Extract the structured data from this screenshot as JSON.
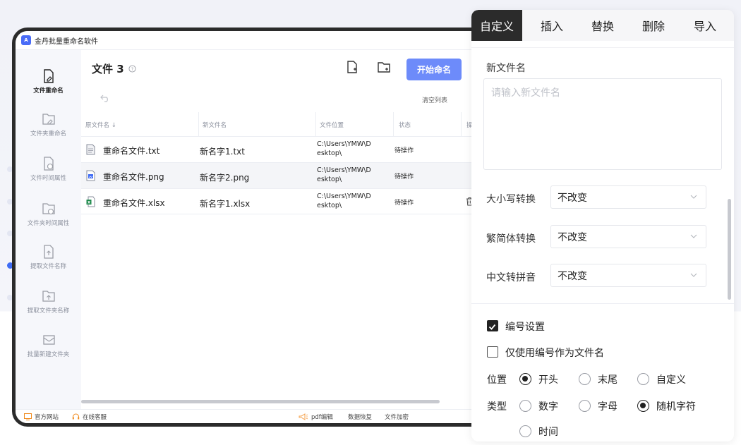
{
  "app": {
    "title": "金丹批量重命名软件"
  },
  "sidebar": {
    "items": [
      {
        "label": "文件重命名",
        "icon": "file-edit-icon"
      },
      {
        "label": "文件夹重命名",
        "icon": "folder-edit-icon"
      },
      {
        "label": "文件时间属性",
        "icon": "file-clock-icon"
      },
      {
        "label": "文件夹时间属性",
        "icon": "folder-clock-icon"
      },
      {
        "label": "提取文件名称",
        "icon": "file-upload-icon"
      },
      {
        "label": "提取文件夹名称",
        "icon": "folder-upload-icon"
      },
      {
        "label": "批量新建文件夹",
        "icon": "folder-batch-icon"
      }
    ]
  },
  "main": {
    "title": "文件 3",
    "start_label": "开始命名",
    "clear_label": "清空列表",
    "columns": [
      "原文件名 ↓",
      "新文件名",
      "文件位置",
      "状态",
      "操"
    ],
    "rows": [
      {
        "old": "重命名文件.txt",
        "new": "新名字1.txt",
        "path": "C:\\Users\\YMW\\D\nesktop\\",
        "status": "待操作",
        "icon": "txt-file-icon"
      },
      {
        "old": "重命名文件.png",
        "new": "新名字2.png",
        "path": "C:\\Users\\YMW\\D\nesktop\\",
        "status": "待操作",
        "icon": "png-file-icon"
      },
      {
        "old": "重命名文件.xlsx",
        "new": "新名字1.xlsx",
        "path": "C:\\Users\\YMW\\D\nesktop\\",
        "status": "待操作",
        "icon": "xlsx-file-icon"
      }
    ]
  },
  "footer": {
    "website": "官方网站",
    "service": "在线客服",
    "pdf": "pdf编辑",
    "recovery": "数据恢复",
    "encrypt": "文件加密"
  },
  "panel": {
    "tabs": [
      "自定义",
      "插入",
      "替换",
      "删除",
      "导入"
    ],
    "new_name_label": "新文件名",
    "new_name_placeholder": "请输入新文件名",
    "case_label": "大小写转换",
    "case_value": "不改变",
    "trad_label": "繁简体转换",
    "trad_value": "不改变",
    "pinyin_label": "中文转拼音",
    "pinyin_value": "不改变",
    "numbering_label": "编号设置",
    "numbering_checked": true,
    "only_number_label": "仅使用编号作为文件名",
    "only_number_checked": false,
    "position_label": "位置",
    "position_options": [
      "开头",
      "末尾",
      "自定义"
    ],
    "position_selected": "开头",
    "type_label": "类型",
    "type_options": [
      "数字",
      "字母",
      "随机字符",
      "时间"
    ],
    "type_selected": "随机字符"
  },
  "colors": {
    "accent": "#6d8bfa",
    "dark": "#2b2b2b"
  }
}
